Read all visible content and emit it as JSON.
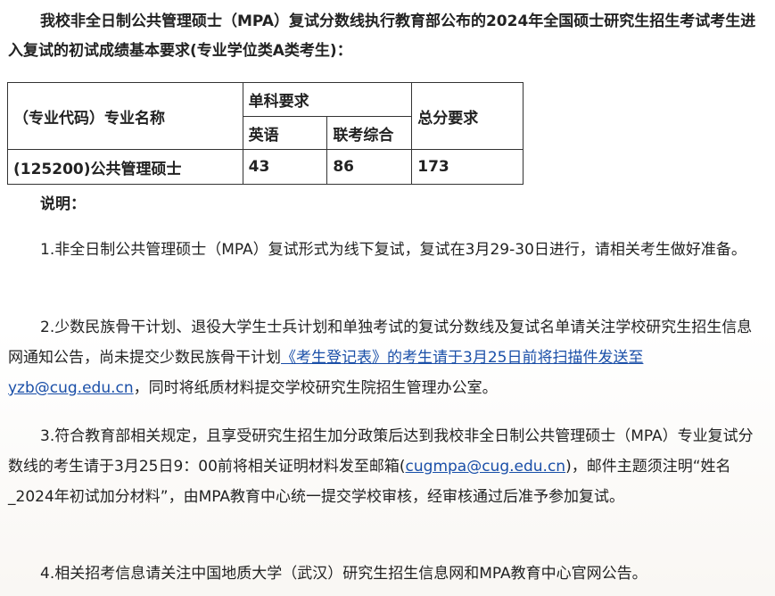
{
  "intro": {
    "text": "我校非全日制公共管理硕士（MPA）复试分数线执行教育部公布的2024年全国硕士研究生招生考试考生进入复试的初试成绩基本要求(专业学位类A类考生)："
  },
  "table": {
    "header_major": "（专业代码）专业名称",
    "header_single": "单科要求",
    "header_english": "英语",
    "header_joint": "联考综合",
    "header_total": "总分要求",
    "row": {
      "major": "(125200)公共管理硕士",
      "english": "43",
      "joint": "86",
      "total": "173"
    }
  },
  "notes_label": "说明：",
  "notes": {
    "n1": "1.非全日制公共管理硕士（MPA）复试形式为线下复试，复试在3月29-30日进行，请相关考生做好准备。",
    "n2_pre": "2.少数民族骨干计划、退役大学生士兵计划和单独考试的复试分数线及复试名单请关注学校研究生招生信息网通知公告，尚未提交少数民族骨干计划",
    "n2_link": "《考生登记表》的考生请于3月25日前将扫描件发送至yzb@cug.edu.cn",
    "n2_post": "，同时将纸质材料提交学校研究生院招生管理办公室。",
    "n3_pre": "3.符合教育部相关规定，且享受研究生招生加分政策后达到我校非全日制公共管理硕士（MPA）专业复试分数线的考生请于3月25日9：00前将相关证明材料发至邮箱(",
    "n3_link": "cugmpa@cug.edu.cn",
    "n3_post": ")，邮件主题须注明“姓名_2024年初试加分材料”，由MPA教育中心统一提交学校审核，经审核通过后准予参加复试。",
    "n4": "4.相关招考信息请关注中国地质大学（武汉）研究生招生信息网和MPA教育中心官网公告。"
  }
}
